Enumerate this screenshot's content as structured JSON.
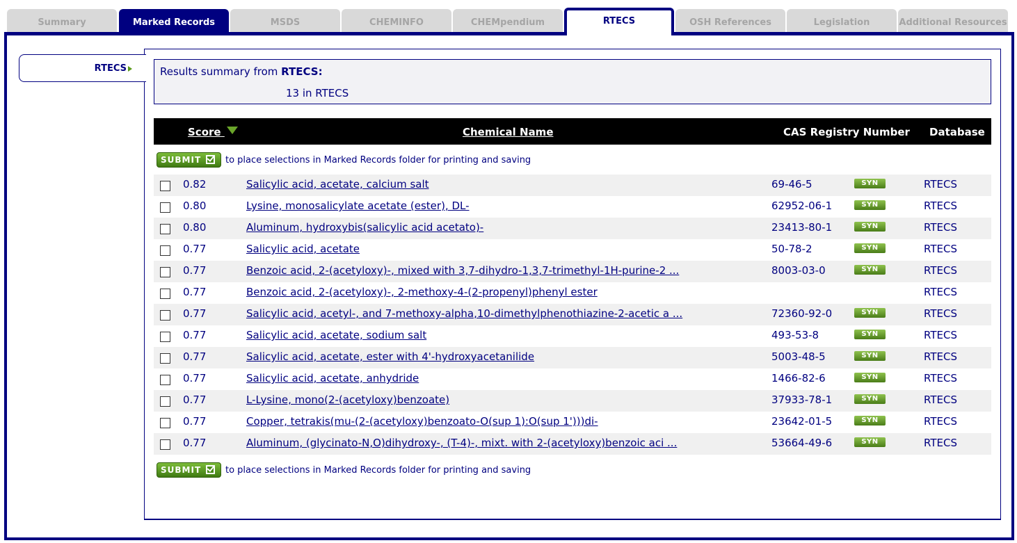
{
  "tabs": [
    {
      "label": "Summary",
      "state": "inactive"
    },
    {
      "label": "Marked Records",
      "state": "marked"
    },
    {
      "label": "MSDS",
      "state": "inactive"
    },
    {
      "label": "CHEMINFO",
      "state": "inactive"
    },
    {
      "label": "CHEMpendium",
      "state": "inactive"
    },
    {
      "label": "RTECS",
      "state": "active"
    },
    {
      "label": "OSH References",
      "state": "inactive"
    },
    {
      "label": "Legislation",
      "state": "inactive"
    },
    {
      "label": "Additional Resources",
      "state": "inactive"
    }
  ],
  "leftnav": {
    "label": "RTECS"
  },
  "summary": {
    "prefix": "Results summary from ",
    "source": "RTECS:",
    "count_line": "13 in RTECS"
  },
  "table": {
    "headers": {
      "score": "Score",
      "name": "Chemical Name",
      "cas": "CAS Registry Number",
      "database": "Database"
    },
    "submit_label": "SUBMIT",
    "submit_text": "to place selections in Marked Records folder for printing and saving",
    "syn_label": "SYN",
    "rows": [
      {
        "score": "0.82",
        "name": "Salicylic acid, acetate, calcium salt",
        "cas": "69-46-5",
        "syn": true,
        "db": "RTECS"
      },
      {
        "score": "0.80",
        "name": "Lysine, monosalicylate acetate (ester), DL-",
        "cas": "62952-06-1",
        "syn": true,
        "db": "RTECS"
      },
      {
        "score": "0.80",
        "name": "Aluminum, hydroxybis(salicylic acid acetato)-",
        "cas": "23413-80-1",
        "syn": true,
        "db": "RTECS"
      },
      {
        "score": "0.77",
        "name": "Salicylic acid, acetate",
        "cas": "50-78-2",
        "syn": true,
        "db": "RTECS"
      },
      {
        "score": "0.77",
        "name": "Benzoic acid, 2-(acetyloxy)-, mixed with 3,7-dihydro-1,3,7-trimethyl-1H-purine-2 ...",
        "cas": "8003-03-0",
        "syn": true,
        "db": "RTECS"
      },
      {
        "score": "0.77",
        "name": "Benzoic acid, 2-(acetyloxy)-, 2-methoxy-4-(2-propenyl)phenyl ester",
        "cas": "",
        "syn": false,
        "db": "RTECS"
      },
      {
        "score": "0.77",
        "name": "Salicylic acid, acetyl-, and 7-methoxy-alpha,10-dimethylphenothiazine-2-acetic a ...",
        "cas": "72360-92-0",
        "syn": true,
        "db": "RTECS"
      },
      {
        "score": "0.77",
        "name": "Salicylic acid, acetate, sodium salt",
        "cas": "493-53-8",
        "syn": true,
        "db": "RTECS"
      },
      {
        "score": "0.77",
        "name": "Salicylic acid, acetate, ester with 4'-hydroxyacetanilide",
        "cas": "5003-48-5",
        "syn": true,
        "db": "RTECS"
      },
      {
        "score": "0.77",
        "name": "Salicylic acid, acetate, anhydride",
        "cas": "1466-82-6",
        "syn": true,
        "db": "RTECS"
      },
      {
        "score": "0.77",
        "name": "L-Lysine, mono(2-(acetyloxy)benzoate)",
        "cas": "37933-78-1",
        "syn": true,
        "db": "RTECS"
      },
      {
        "score": "0.77",
        "name": "Copper, tetrakis(mu-(2-(acetyloxy)benzoato-O(sup 1):O(sup 1')))di-",
        "cas": "23642-01-5",
        "syn": true,
        "db": "RTECS"
      },
      {
        "score": "0.77",
        "name": "Aluminum, (glycinato-N,O)dihydroxy-, (T-4)-, mixt. with 2-(acetyloxy)benzoic aci ...",
        "cas": "53664-49-6",
        "syn": true,
        "db": "RTECS"
      }
    ]
  }
}
